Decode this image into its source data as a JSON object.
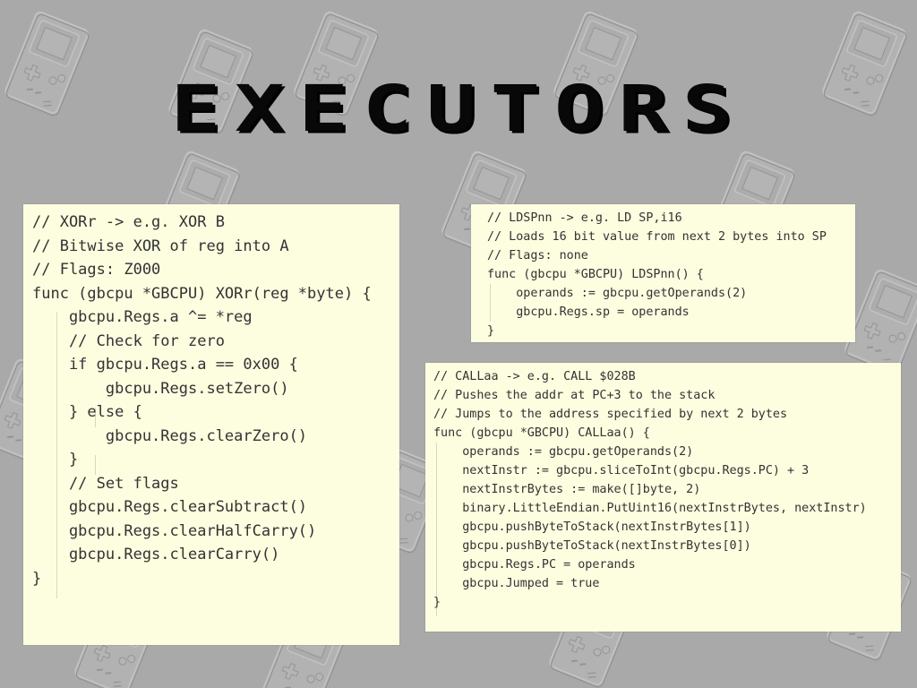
{
  "title": "EXECUTORS",
  "panels": {
    "xor": {
      "lines": [
        "// XORr -> e.g. XOR B",
        "// Bitwise XOR of reg into A",
        "// Flags: Z000",
        "func (gbcpu *GBCPU) XORr(reg *byte) {",
        "    gbcpu.Regs.a ^= *reg",
        "",
        "    // Check for zero",
        "    if gbcpu.Regs.a == 0x00 {",
        "        gbcpu.Regs.setZero()",
        "    } else {",
        "        gbcpu.Regs.clearZero()",
        "    }",
        "",
        "    // Set flags",
        "    gbcpu.Regs.clearSubtract()",
        "    gbcpu.Regs.clearHalfCarry()",
        "    gbcpu.Regs.clearCarry()",
        "}"
      ]
    },
    "ldspnn": {
      "lines": [
        "// LDSPnn -> e.g. LD SP,i16",
        "// Loads 16 bit value from next 2 bytes into SP",
        "// Flags: none",
        "func (gbcpu *GBCPU) LDSPnn() {",
        "    operands := gbcpu.getOperands(2)",
        "    gbcpu.Regs.sp = operands",
        "}"
      ]
    },
    "callaa": {
      "lines": [
        "// CALLaa -> e.g. CALL $028B",
        "// Pushes the addr at PC+3 to the stack",
        "// Jumps to the address specified by next 2 bytes",
        "func (gbcpu *GBCPU) CALLaa() {",
        "    operands := gbcpu.getOperands(2)",
        "    nextInstr := gbcpu.sliceToInt(gbcpu.Regs.PC) + 3",
        "    nextInstrBytes := make([]byte, 2)",
        "    binary.LittleEndian.PutUint16(nextInstrBytes, nextInstr)",
        "    gbcpu.pushByteToStack(nextInstrBytes[1])",
        "    gbcpu.pushByteToStack(nextInstrBytes[0])",
        "    gbcpu.Regs.PC = operands",
        "",
        "    gbcpu.Jumped = true",
        "}"
      ]
    }
  }
}
